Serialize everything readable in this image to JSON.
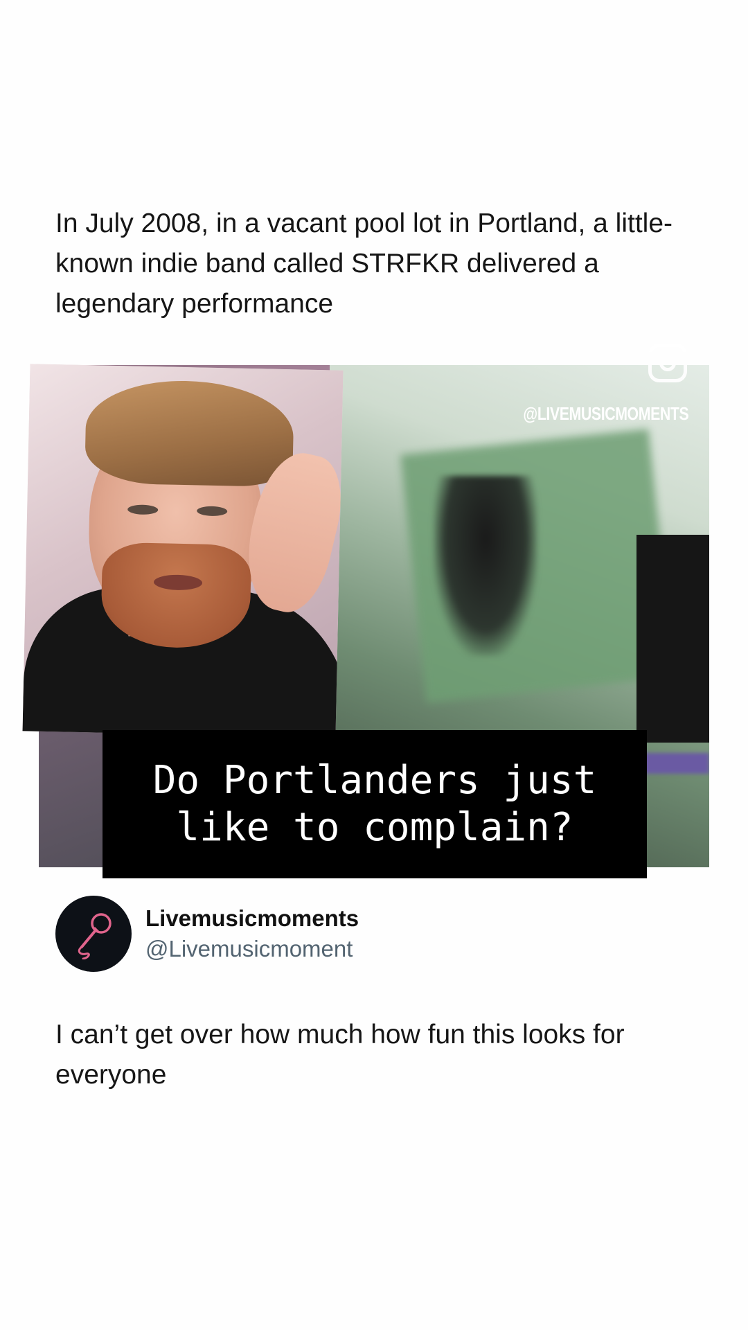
{
  "post": {
    "text": "In July 2008, in a vacant pool lot in Portland, a little-known indie band called STRFKR delivered a legendary performance"
  },
  "media": {
    "watermark": "@LIVEMUSICMOMENTS",
    "overlay_icon": "instagram-icon",
    "facecam_description_icon": "facecam-overlay"
  },
  "caption": {
    "line1": "Do Portlanders just",
    "line2": "like to complain?"
  },
  "author": {
    "avatar_icon": "microphone-icon",
    "display_name": "Livemusicmoments",
    "handle": "@Livemusicmoment"
  },
  "reply": {
    "text": "I can’t get over how much how fun this looks for everyone"
  },
  "colors": {
    "background": "#fefefe",
    "caption_bg": "#000000",
    "caption_text": "#ffffff",
    "avatar_bg": "#0d1117",
    "avatar_accent": "#e0648c",
    "handle_color": "#536471"
  }
}
